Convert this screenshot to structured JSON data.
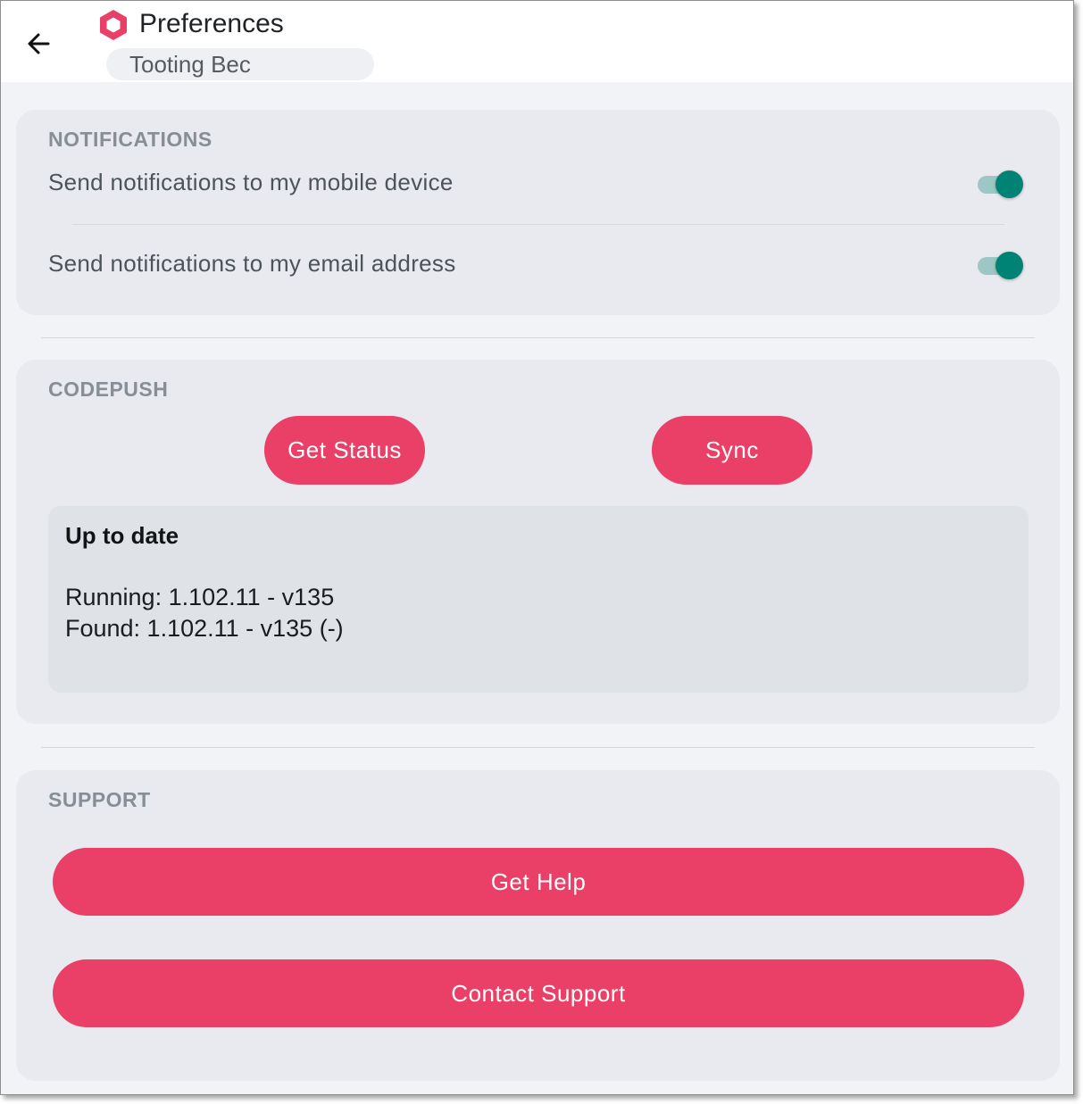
{
  "header": {
    "title": "Preferences",
    "location": "Tooting Bec"
  },
  "notifications": {
    "section_title": "NOTIFICATIONS",
    "items": [
      {
        "label": "Send notifications to my mobile device",
        "enabled": true
      },
      {
        "label": "Send notifications to my email address",
        "enabled": true
      }
    ]
  },
  "codepush": {
    "section_title": "CODEPUSH",
    "get_status_label": "Get Status",
    "sync_label": "Sync",
    "status": {
      "heading": "Up to date",
      "running": "Running: 1.102.11 - v135",
      "found": "Found: 1.102.11 - v135 (-)"
    }
  },
  "support": {
    "section_title": "SUPPORT",
    "get_help_label": "Get Help",
    "contact_support_label": "Contact Support"
  },
  "colors": {
    "accent": "#ea3f66",
    "toggle_on": "#008374",
    "toggle_track": "#9cc7c4",
    "card_background": "#e8eaef",
    "page_background": "#f2f3f7"
  },
  "icons": {
    "back": "arrow-left-icon",
    "logo": "hexagon-logo-icon"
  }
}
